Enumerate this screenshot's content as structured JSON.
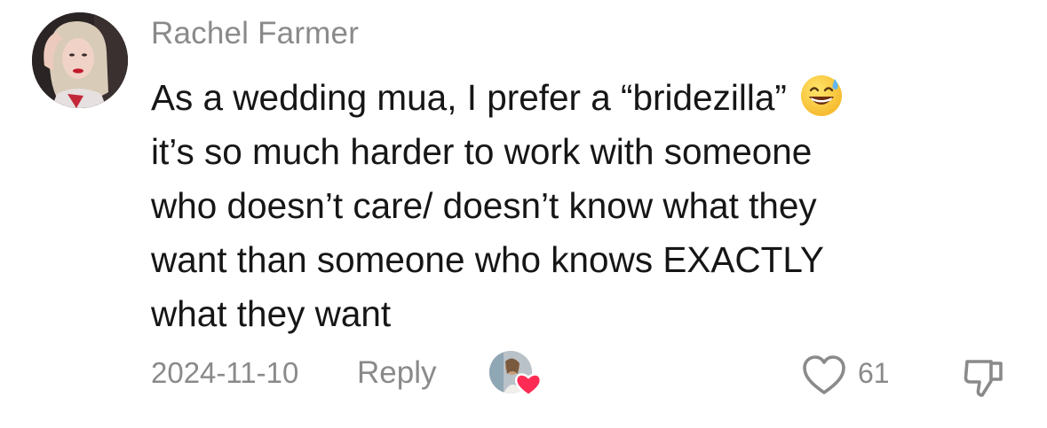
{
  "comment": {
    "username": "Rachel Farmer",
    "text_lines": [
      "As a wedding mua, I prefer a “bridezilla”",
      "it’s so much harder to work with someone",
      "who doesn’t care/ doesn’t know what they",
      "want than someone who knows EXACTLY",
      "what they want"
    ],
    "emoji_icon": "sweat-smile-emoji-icon",
    "date": "2024-11-10",
    "reply_label": "Reply",
    "like_count": "61"
  },
  "icons": {
    "like": "heart-outline-icon",
    "dislike": "thumbs-down-icon",
    "creator_liked": "creator-heart-icon"
  },
  "colors": {
    "text": "#161616",
    "muted": "#8a8a8a",
    "heart_badge": "#fe2c55"
  }
}
